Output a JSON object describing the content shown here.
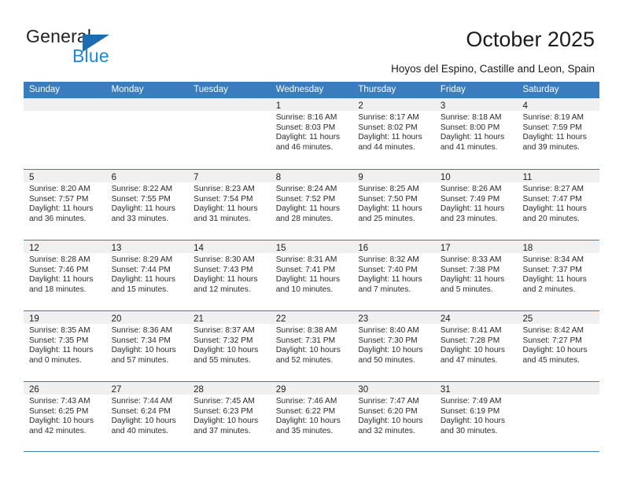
{
  "brand": {
    "word1": "General",
    "word2": "Blue",
    "logo_icon": "triangle-logo-icon",
    "accent_dark": "#1b6cb3",
    "accent_light": "#1a87da"
  },
  "header": {
    "title": "October 2025",
    "subtitle": "Hoyos del Espino, Castille and Leon, Spain"
  },
  "theme": {
    "header_bg": "#3a7cbe",
    "header_text": "#ffffff",
    "day_band_bg": "#f0f0f0",
    "row_divider": "#3a7cbe"
  },
  "calendar": {
    "weekdays": [
      "Sunday",
      "Monday",
      "Tuesday",
      "Wednesday",
      "Thursday",
      "Friday",
      "Saturday"
    ],
    "weeks": [
      [
        {
          "day": "",
          "lines": []
        },
        {
          "day": "",
          "lines": []
        },
        {
          "day": "",
          "lines": []
        },
        {
          "day": "1",
          "lines": [
            "Sunrise: 8:16 AM",
            "Sunset: 8:03 PM",
            "Daylight: 11 hours",
            "and 46 minutes."
          ]
        },
        {
          "day": "2",
          "lines": [
            "Sunrise: 8:17 AM",
            "Sunset: 8:02 PM",
            "Daylight: 11 hours",
            "and 44 minutes."
          ]
        },
        {
          "day": "3",
          "lines": [
            "Sunrise: 8:18 AM",
            "Sunset: 8:00 PM",
            "Daylight: 11 hours",
            "and 41 minutes."
          ]
        },
        {
          "day": "4",
          "lines": [
            "Sunrise: 8:19 AM",
            "Sunset: 7:59 PM",
            "Daylight: 11 hours",
            "and 39 minutes."
          ]
        }
      ],
      [
        {
          "day": "5",
          "lines": [
            "Sunrise: 8:20 AM",
            "Sunset: 7:57 PM",
            "Daylight: 11 hours",
            "and 36 minutes."
          ]
        },
        {
          "day": "6",
          "lines": [
            "Sunrise: 8:22 AM",
            "Sunset: 7:55 PM",
            "Daylight: 11 hours",
            "and 33 minutes."
          ]
        },
        {
          "day": "7",
          "lines": [
            "Sunrise: 8:23 AM",
            "Sunset: 7:54 PM",
            "Daylight: 11 hours",
            "and 31 minutes."
          ]
        },
        {
          "day": "8",
          "lines": [
            "Sunrise: 8:24 AM",
            "Sunset: 7:52 PM",
            "Daylight: 11 hours",
            "and 28 minutes."
          ]
        },
        {
          "day": "9",
          "lines": [
            "Sunrise: 8:25 AM",
            "Sunset: 7:50 PM",
            "Daylight: 11 hours",
            "and 25 minutes."
          ]
        },
        {
          "day": "10",
          "lines": [
            "Sunrise: 8:26 AM",
            "Sunset: 7:49 PM",
            "Daylight: 11 hours",
            "and 23 minutes."
          ]
        },
        {
          "day": "11",
          "lines": [
            "Sunrise: 8:27 AM",
            "Sunset: 7:47 PM",
            "Daylight: 11 hours",
            "and 20 minutes."
          ]
        }
      ],
      [
        {
          "day": "12",
          "lines": [
            "Sunrise: 8:28 AM",
            "Sunset: 7:46 PM",
            "Daylight: 11 hours",
            "and 18 minutes."
          ]
        },
        {
          "day": "13",
          "lines": [
            "Sunrise: 8:29 AM",
            "Sunset: 7:44 PM",
            "Daylight: 11 hours",
            "and 15 minutes."
          ]
        },
        {
          "day": "14",
          "lines": [
            "Sunrise: 8:30 AM",
            "Sunset: 7:43 PM",
            "Daylight: 11 hours",
            "and 12 minutes."
          ]
        },
        {
          "day": "15",
          "lines": [
            "Sunrise: 8:31 AM",
            "Sunset: 7:41 PM",
            "Daylight: 11 hours",
            "and 10 minutes."
          ]
        },
        {
          "day": "16",
          "lines": [
            "Sunrise: 8:32 AM",
            "Sunset: 7:40 PM",
            "Daylight: 11 hours",
            "and 7 minutes."
          ]
        },
        {
          "day": "17",
          "lines": [
            "Sunrise: 8:33 AM",
            "Sunset: 7:38 PM",
            "Daylight: 11 hours",
            "and 5 minutes."
          ]
        },
        {
          "day": "18",
          "lines": [
            "Sunrise: 8:34 AM",
            "Sunset: 7:37 PM",
            "Daylight: 11 hours",
            "and 2 minutes."
          ]
        }
      ],
      [
        {
          "day": "19",
          "lines": [
            "Sunrise: 8:35 AM",
            "Sunset: 7:35 PM",
            "Daylight: 11 hours",
            "and 0 minutes."
          ]
        },
        {
          "day": "20",
          "lines": [
            "Sunrise: 8:36 AM",
            "Sunset: 7:34 PM",
            "Daylight: 10 hours",
            "and 57 minutes."
          ]
        },
        {
          "day": "21",
          "lines": [
            "Sunrise: 8:37 AM",
            "Sunset: 7:32 PM",
            "Daylight: 10 hours",
            "and 55 minutes."
          ]
        },
        {
          "day": "22",
          "lines": [
            "Sunrise: 8:38 AM",
            "Sunset: 7:31 PM",
            "Daylight: 10 hours",
            "and 52 minutes."
          ]
        },
        {
          "day": "23",
          "lines": [
            "Sunrise: 8:40 AM",
            "Sunset: 7:30 PM",
            "Daylight: 10 hours",
            "and 50 minutes."
          ]
        },
        {
          "day": "24",
          "lines": [
            "Sunrise: 8:41 AM",
            "Sunset: 7:28 PM",
            "Daylight: 10 hours",
            "and 47 minutes."
          ]
        },
        {
          "day": "25",
          "lines": [
            "Sunrise: 8:42 AM",
            "Sunset: 7:27 PM",
            "Daylight: 10 hours",
            "and 45 minutes."
          ]
        }
      ],
      [
        {
          "day": "26",
          "lines": [
            "Sunrise: 7:43 AM",
            "Sunset: 6:25 PM",
            "Daylight: 10 hours",
            "and 42 minutes."
          ]
        },
        {
          "day": "27",
          "lines": [
            "Sunrise: 7:44 AM",
            "Sunset: 6:24 PM",
            "Daylight: 10 hours",
            "and 40 minutes."
          ]
        },
        {
          "day": "28",
          "lines": [
            "Sunrise: 7:45 AM",
            "Sunset: 6:23 PM",
            "Daylight: 10 hours",
            "and 37 minutes."
          ]
        },
        {
          "day": "29",
          "lines": [
            "Sunrise: 7:46 AM",
            "Sunset: 6:22 PM",
            "Daylight: 10 hours",
            "and 35 minutes."
          ]
        },
        {
          "day": "30",
          "lines": [
            "Sunrise: 7:47 AM",
            "Sunset: 6:20 PM",
            "Daylight: 10 hours",
            "and 32 minutes."
          ]
        },
        {
          "day": "31",
          "lines": [
            "Sunrise: 7:49 AM",
            "Sunset: 6:19 PM",
            "Daylight: 10 hours",
            "and 30 minutes."
          ]
        },
        {
          "day": "",
          "lines": []
        }
      ]
    ]
  }
}
